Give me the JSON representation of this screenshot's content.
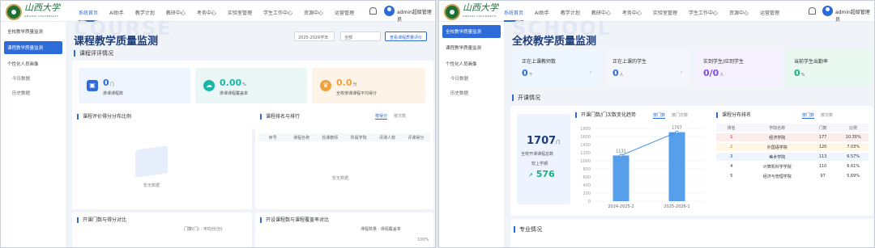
{
  "app": {
    "logo_text": "山西大学",
    "logo_sub": "SHANXI UNIVERSITY",
    "nav": [
      "系统首页",
      "AI助手",
      "教学计划",
      "教研中心",
      "考务中心",
      "实验室管理",
      "学生工作中心",
      "资源中心",
      "运营管理"
    ],
    "active_nav": 0,
    "user": "admin超级管理员"
  },
  "sidebar": {
    "items": [
      "全校教学质量监测",
      "课程教学质量监测"
    ],
    "group": "个性化人员画像",
    "subs": [
      "今日数据",
      "历史数据"
    ]
  },
  "left": {
    "watermark": "COURSE",
    "title": "课程教学质量监测",
    "year": "2025-2026学年",
    "scope": "全部",
    "export_btn": "查看课程质量评价",
    "section": "课程评评情况",
    "stats": [
      {
        "value": "0",
        "unit": "门",
        "label": "排课课程数",
        "color": "#eef5ff",
        "accent": "#2d6bd8",
        "icon": "book-icon"
      },
      {
        "value": "0.00",
        "unit": "%",
        "label": "排课课程覆盖率",
        "color": "#eaf7f6",
        "accent": "#19b7a6",
        "icon": "cloud-icon"
      },
      {
        "value": "0.0",
        "unit": "分",
        "label": "全校排课课程平均得分",
        "color": "#fdf3e6",
        "accent": "#f0a13c",
        "icon": "crown-icon"
      }
    ],
    "panel1_title": "课程评价得分分布比例",
    "panel2_title": "课程排名与排行",
    "panel2_tabs": [
      "按得分",
      "按次数"
    ],
    "table_headers": [
      "序号",
      "课程名称",
      "授课教师",
      "所属学院",
      "评课人数",
      "评课得分"
    ],
    "empty": "暂无数据",
    "panel3_title": "开课门数与得分对比",
    "panel3_legend": [
      "门数(门)",
      "平均分(分)"
    ],
    "panel4_title": "开设课程数与课程覆盖率对比",
    "panel4_legend": [
      "课程数量",
      "课程覆盖率"
    ],
    "pct": "100%"
  },
  "right": {
    "watermark": "SCHOOL",
    "title": "全校教学质量监测",
    "stats": [
      {
        "label": "正在上课教师数",
        "value": "0",
        "unit": "个",
        "color": "#eef6ff",
        "vcolor": "#2d6bd8"
      },
      {
        "label": "正在上课的学生",
        "value": "0",
        "unit": "人",
        "color": "#f4f6fb",
        "vcolor": "#2d6bd8"
      },
      {
        "label": "实到学生/应到学生",
        "value": "0/0",
        "unit": "人",
        "color": "#f5f1ff",
        "vcolor": "#7b4ee6"
      },
      {
        "label": "当前学生出勤率",
        "value": "0",
        "unit": "%",
        "color": "#eaf8f2",
        "vcolor": "#19b07a"
      }
    ],
    "section1": "开课情况",
    "total": "1707",
    "total_unit": "门",
    "total_label": "全校开课课程总数",
    "growth_label": "较上学期",
    "growth": "576",
    "chart_title": "开课门数/门次数变化趋势",
    "chart_tabs": [
      "按门数",
      "按门次数"
    ],
    "rank_title": "课程分布排名",
    "rank_tabs": [
      "按门数",
      "按次数"
    ],
    "rank_headers": [
      "排名",
      "学院名称",
      "门数",
      "比例"
    ],
    "rank_rows": [
      [
        "1",
        "经济学院",
        "177",
        "10.35%"
      ],
      [
        "2",
        "外国语学院",
        "120",
        "7.03%"
      ],
      [
        "3",
        "美术学院",
        "113",
        "6.57%"
      ],
      [
        "4",
        "计算机科学学院",
        "110",
        "6.61%"
      ],
      [
        "5",
        "经济与管理学院",
        "97",
        "5.69%"
      ]
    ],
    "section2": "专业情况"
  },
  "chart_data": {
    "type": "line",
    "title": "开课门数/门次数变化趋势",
    "categories": [
      "2024-2025-2",
      "2025-2026-1"
    ],
    "series": [
      {
        "values": [
          1131,
          1707
        ]
      }
    ],
    "ylim": [
      0,
      1800
    ],
    "yticks": [
      0,
      200,
      400,
      600,
      800,
      1000,
      1200,
      1400,
      1600,
      1800
    ]
  }
}
